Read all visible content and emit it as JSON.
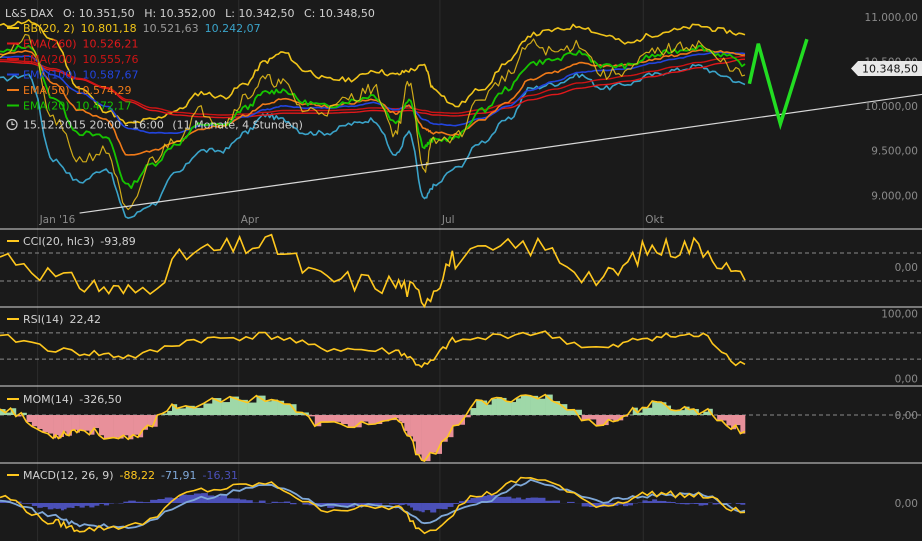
{
  "colors": {
    "background": "#1a1a1a",
    "separator": "#d8d8d8",
    "grid": "#2c2c2c",
    "bb_upper": "#f0c419",
    "bb_mid": "#999999",
    "bb_lower": "#3aa3c9",
    "ema260": "#e0181b",
    "ema200": "#cc1414",
    "ema100": "#2244dd",
    "ema50": "#f07a18",
    "ema20": "#16c400",
    "indicator": "#ffc81e",
    "mom_pos": "#9fd8a8",
    "mom_neg": "#e8909a",
    "macd_hist": "#4b50b8",
    "macd_signal": "#7fa8d8",
    "forecast": "#22dd22",
    "trendline": "#d8d8d8",
    "price_tag_bg": "#e8e8e8"
  },
  "header": {
    "symbol": "L&S DAX",
    "open": "O: 10.351,50",
    "high": "H: 10.352,00",
    "low": "L: 10.342,50",
    "close": "C: 10.348,50",
    "range": "15.12.2015 20:00 - 16:00",
    "period": "(11 Monate, 4 Stunden)"
  },
  "legend": [
    {
      "name": "BB(20, 2)",
      "values": [
        "10.801,18",
        "10.521,63",
        "10.242,07"
      ],
      "colors": [
        "#f0c419",
        "#999999",
        "#3aa3c9"
      ],
      "icon": "line-icon",
      "icon_color": "#f0c419"
    },
    {
      "name": "EMA(260)",
      "values": [
        "10.526,21"
      ],
      "colors": [
        "#e0181b"
      ],
      "icon": "line-icon",
      "icon_color": "#e0181b"
    },
    {
      "name": "EMA(200)",
      "values": [
        "10.555,76"
      ],
      "colors": [
        "#cc1414"
      ],
      "icon": "line-icon",
      "icon_color": "#cc1414"
    },
    {
      "name": "EMA(100)",
      "values": [
        "10.587,67"
      ],
      "colors": [
        "#2244dd"
      ],
      "icon": "line-icon",
      "icon_color": "#2244dd"
    },
    {
      "name": "EMA(50)",
      "values": [
        "10.574,29"
      ],
      "colors": [
        "#f07a18"
      ],
      "icon": "line-icon",
      "icon_color": "#f07a18"
    },
    {
      "name": "EMA(20)",
      "values": [
        "10.472,17"
      ],
      "colors": [
        "#16c400"
      ],
      "icon": "line-icon",
      "icon_color": "#16c400"
    }
  ],
  "current_price": "10.348,50",
  "indicators": {
    "cci": {
      "name": "CCI(20, hlc3)",
      "value": "-93,89",
      "levels": [
        "0,00"
      ]
    },
    "rsi": {
      "name": "RSI(14)",
      "value": "22,42",
      "levels": [
        "100,00",
        "0,00"
      ]
    },
    "mom": {
      "name": "MOM(14)",
      "value": "-326,50",
      "levels": [
        "0,00"
      ]
    },
    "macd": {
      "name": "MACD(12, 26, 9)",
      "values": [
        "-88,22",
        "-71,91",
        "-16,31"
      ],
      "colors": [
        "#ffc81e",
        "#7fa8d8",
        "#4b50b8"
      ],
      "levels": [
        "0,00"
      ]
    }
  },
  "chart_data": [
    {
      "type": "line",
      "title": "L&S DAX",
      "ylim": [
        8700,
        11100
      ],
      "yticks": [
        "9.000,00",
        "9.500,00",
        "10.000,00",
        "10.500,00",
        "11.000,00"
      ],
      "ytick_values": [
        9000,
        9500,
        10000,
        10500,
        11000
      ],
      "xticks": [
        "Jan '16",
        "Apr",
        "Jul",
        "Okt"
      ],
      "xtick_dates": [
        "2016-01-01",
        "2016-04-01",
        "2016-07-01",
        "2016-10-01"
      ],
      "x": [
        "2015-12-15",
        "2015-12-28",
        "2016-01-08",
        "2016-01-20",
        "2016-02-01",
        "2016-02-11",
        "2016-02-22",
        "2016-03-04",
        "2016-03-15",
        "2016-03-25",
        "2016-04-04",
        "2016-04-13",
        "2016-04-21",
        "2016-05-01",
        "2016-05-11",
        "2016-05-22",
        "2016-06-01",
        "2016-06-11",
        "2016-06-17",
        "2016-06-24",
        "2016-06-28",
        "2016-07-08",
        "2016-07-20",
        "2016-08-01",
        "2016-08-11",
        "2016-08-22",
        "2016-09-02",
        "2016-09-13",
        "2016-09-24",
        "2016-10-05",
        "2016-10-15",
        "2016-10-26",
        "2016-11-05",
        "2016-11-16"
      ],
      "series": [
        {
          "name": "DAX",
          "values": [
            10600,
            10750,
            9850,
            9400,
            9500,
            8800,
            9400,
            9650,
            9950,
            9800,
            10100,
            10300,
            10250,
            9950,
            9950,
            10100,
            10200,
            9700,
            10250,
            9300,
            9600,
            9650,
            10100,
            10350,
            10700,
            10600,
            10700,
            10350,
            10400,
            10600,
            10650,
            10700,
            10500,
            10348
          ]
        },
        {
          "name": "EMA(260)",
          "values": [
            10500,
            10480,
            10400,
            10300,
            10200,
            10050,
            9950,
            9900,
            9880,
            9870,
            9880,
            9900,
            9920,
            9920,
            9920,
            9930,
            9950,
            9940,
            9950,
            9920,
            9900,
            9890,
            9920,
            9980,
            10070,
            10130,
            10200,
            10240,
            10280,
            10330,
            10380,
            10430,
            10480,
            10526
          ]
        },
        {
          "name": "EMA(200)",
          "values": [
            10520,
            10500,
            10420,
            10310,
            10210,
            10070,
            9980,
            9930,
            9910,
            9900,
            9910,
            9930,
            9950,
            9950,
            9950,
            9960,
            9980,
            9970,
            9980,
            9950,
            9930,
            9920,
            9960,
            10030,
            10120,
            10190,
            10260,
            10300,
            10340,
            10390,
            10440,
            10490,
            10530,
            10556
          ]
        },
        {
          "name": "EMA(100)",
          "values": [
            10550,
            10560,
            10350,
            10150,
            10000,
            9750,
            9700,
            9700,
            9780,
            9800,
            9880,
            9960,
            10000,
            9980,
            9980,
            10000,
            10040,
            9960,
            10000,
            9850,
            9800,
            9780,
            9860,
            10000,
            10180,
            10280,
            10380,
            10400,
            10420,
            10480,
            10530,
            10580,
            10600,
            10588
          ]
        },
        {
          "name": "EMA(50)",
          "values": [
            10580,
            10620,
            10250,
            9950,
            9850,
            9450,
            9500,
            9600,
            9750,
            9780,
            9900,
            10020,
            10080,
            10020,
            10000,
            10030,
            10080,
            9920,
            10000,
            9750,
            9700,
            9680,
            9850,
            10050,
            10300,
            10380,
            10480,
            10450,
            10460,
            10520,
            10570,
            10620,
            10610,
            10574
          ]
        },
        {
          "name": "EMA(20)",
          "values": [
            10600,
            10680,
            10100,
            9700,
            9650,
            9100,
            9350,
            9580,
            9800,
            9780,
            9980,
            10150,
            10180,
            10040,
            10000,
            10060,
            10120,
            9820,
            10080,
            9550,
            9620,
            9640,
            9950,
            10200,
            10480,
            10520,
            10600,
            10450,
            10450,
            10560,
            10620,
            10660,
            10580,
            10472
          ]
        },
        {
          "name": "BB upper",
          "values": [
            10900,
            10950,
            10750,
            10200,
            9950,
            9800,
            9850,
            9950,
            10150,
            10100,
            10250,
            10500,
            10600,
            10400,
            10300,
            10300,
            10400,
            10350,
            10400,
            10450,
            10200,
            10000,
            10200,
            10500,
            10800,
            10850,
            10900,
            10800,
            10700,
            10800,
            10850,
            10900,
            10850,
            10801
          ]
        },
        {
          "name": "BB lower",
          "values": [
            10300,
            10350,
            9400,
            9150,
            9300,
            8750,
            8900,
            9250,
            9500,
            9500,
            9700,
            9900,
            9850,
            9700,
            9700,
            9800,
            9850,
            9450,
            9700,
            8950,
            9100,
            9300,
            9600,
            9850,
            10200,
            10250,
            10350,
            10200,
            10250,
            10350,
            10400,
            10450,
            10350,
            10242
          ]
        }
      ],
      "forecast": {
        "x": [
          "2016-11-18",
          "2016-11-22",
          "2016-12-02",
          "2016-12-14"
        ],
        "values": [
          10250,
          10700,
          9800,
          10750
        ]
      },
      "trendline": {
        "x": [
          "2016-01-20",
          "2016-11-30"
        ],
        "values": [
          8800,
          9900
        ]
      }
    },
    {
      "type": "line",
      "title": "CCI(20, hlc3)",
      "ylim": [
        -250,
        250
      ],
      "yticks": [
        "0,00"
      ],
      "ytick_values": [
        0
      ],
      "dashed_levels": [
        100,
        -100
      ],
      "x": [
        "2015-12-15",
        "2016-01-20",
        "2016-02-11",
        "2016-03-15",
        "2016-04-13",
        "2016-05-11",
        "2016-06-11",
        "2016-06-24",
        "2016-07-08",
        "2016-08-11",
        "2016-09-13",
        "2016-10-05",
        "2016-10-26",
        "2016-11-16"
      ],
      "series": [
        {
          "name": "CCI",
          "values": [
            80,
            -120,
            -180,
            110,
            160,
            -90,
            -120,
            -210,
            60,
            150,
            -80,
            130,
            150,
            -94
          ]
        }
      ]
    },
    {
      "type": "line",
      "title": "RSI(14)",
      "ylim": [
        -5,
        105
      ],
      "yticks": [
        "100,00",
        "0,00"
      ],
      "ytick_values": [
        100,
        0
      ],
      "dashed_levels": [
        70,
        30
      ],
      "x": [
        "2015-12-15",
        "2016-01-20",
        "2016-02-11",
        "2016-03-15",
        "2016-04-13",
        "2016-05-11",
        "2016-06-11",
        "2016-06-24",
        "2016-07-08",
        "2016-08-11",
        "2016-09-13",
        "2016-10-05",
        "2016-10-26",
        "2016-11-16"
      ],
      "series": [
        {
          "name": "RSI",
          "values": [
            62,
            40,
            34,
            60,
            66,
            46,
            42,
            20,
            58,
            70,
            46,
            64,
            66,
            22
          ]
        }
      ]
    },
    {
      "type": "area",
      "title": "MOM(14)",
      "ylim": [
        -900,
        500
      ],
      "yticks": [
        "0,00"
      ],
      "ytick_values": [
        0
      ],
      "dashed_levels": [
        0
      ],
      "x": [
        "2015-12-15",
        "2016-01-08",
        "2016-01-20",
        "2016-02-11",
        "2016-03-04",
        "2016-04-13",
        "2016-05-11",
        "2016-06-11",
        "2016-06-24",
        "2016-07-20",
        "2016-08-11",
        "2016-09-13",
        "2016-10-05",
        "2016-10-26",
        "2016-11-16"
      ],
      "series": [
        {
          "name": "MOM",
          "values": [
            150,
            -400,
            -300,
            -500,
            200,
            350,
            -200,
            -150,
            -850,
            250,
            400,
            -150,
            200,
            100,
            -327
          ]
        }
      ]
    },
    {
      "type": "line",
      "title": "MACD(12, 26, 9)",
      "ylim": [
        -350,
        350
      ],
      "yticks": [
        "0,00"
      ],
      "ytick_values": [
        0
      ],
      "x": [
        "2015-12-15",
        "2016-01-08",
        "2016-01-20",
        "2016-02-11",
        "2016-03-15",
        "2016-04-13",
        "2016-05-11",
        "2016-06-11",
        "2016-06-24",
        "2016-07-20",
        "2016-08-11",
        "2016-09-13",
        "2016-10-05",
        "2016-10-26",
        "2016-11-16"
      ],
      "series": [
        {
          "name": "MACD",
          "values": [
            60,
            -180,
            -250,
            -220,
            120,
            180,
            -60,
            -40,
            -260,
            80,
            240,
            -20,
            90,
            70,
            -88
          ]
        },
        {
          "name": "Signal",
          "values": [
            40,
            -120,
            -210,
            -230,
            40,
            170,
            -20,
            -30,
            -180,
            10,
            200,
            20,
            70,
            80,
            -72
          ]
        },
        {
          "name": "Histogram",
          "values": [
            20,
            -60,
            -40,
            10,
            80,
            10,
            -40,
            -10,
            -80,
            70,
            40,
            -40,
            20,
            -10,
            -16
          ]
        }
      ]
    }
  ]
}
